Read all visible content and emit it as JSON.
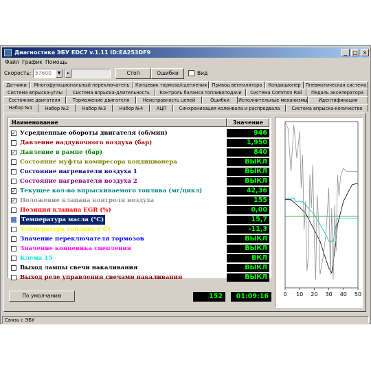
{
  "window": {
    "title": "Диагностика ЭБУ EDC7 v.1.11 ID:EA253DF9",
    "min": "_",
    "max": "□",
    "close": "×"
  },
  "menu": [
    "Файл",
    "График",
    "Помощь"
  ],
  "toolbar": {
    "speed_label": "Скорость:",
    "speed_value": "57600",
    "stop_label": "Стоп",
    "errors_label": "Ошибки",
    "view_label": "Вид"
  },
  "tabs": {
    "row1": [
      "Датчики",
      "Многофункциональный переключатель",
      "Концевик тормоза/сцепления",
      "Привод вентилятора",
      "Кондиционер",
      "Пневматическая система"
    ],
    "row2": [
      "Система впрыска-углы",
      "Система впрыска-длительность",
      "Контроль баланса топливоподачи",
      "Система Common Rail",
      "Педаль акселератора"
    ],
    "row3": [
      "Состояние двигателя",
      "Торможение двигателя",
      "Неисправность цепей",
      "Ошибки",
      "Исполнительные механизмы",
      "Идентификация"
    ],
    "row4": [
      "Набор №1",
      "Набор №2",
      "Набор №3",
      "Набор №4",
      "АЦП",
      "Синхронизация коленвала и распредвала",
      "Система впрыска-количество"
    ],
    "active": "Набор №1"
  },
  "table": {
    "header_name": "Наименование",
    "header_value": "Значение",
    "rows": [
      {
        "label": "Усредненные обороты двигателя (об/мин)",
        "value": "946",
        "checked": true,
        "color": "#000000"
      },
      {
        "label": "Давление наддувочного воздуха (бар)",
        "value": "1,950",
        "checked": false,
        "color": "#a00000"
      },
      {
        "label": "Давление в рампе (бар)",
        "value": "840",
        "checked": true,
        "color": "#008000"
      },
      {
        "label": "Состояние муфты компресора кондиционера",
        "value": "ВЫКЛ",
        "checked": false,
        "color": "#808000"
      },
      {
        "label": "Состояние нагревателя воздуха 1",
        "value": "ВЫКЛ",
        "checked": false,
        "color": "#000080"
      },
      {
        "label": "Состояние нагревателя воздуха 2",
        "value": "ВЫКЛ",
        "checked": false,
        "color": "#800080"
      },
      {
        "label": "Текущее кол-во впрыскиваемого топлива (мг/цикл)",
        "value": "42,36",
        "checked": true,
        "color": "#008080"
      },
      {
        "label": "Положение клапана контроля воздуха",
        "value": "155",
        "checked": true,
        "color": "#909090"
      },
      {
        "label": "Позиция клапана EGR (%)",
        "value": "0,00",
        "checked": false,
        "color": "#ff0000"
      },
      {
        "label": "Температура масла (°C)",
        "value": "15,7",
        "checked": false,
        "color": "#ffffff",
        "selected": true
      },
      {
        "label": "Температура топлива (°C)",
        "value": "-11,3",
        "checked": false,
        "color": "#ffff00"
      },
      {
        "label": "Значение переключателя тормозов",
        "value": "ВЫКЛ",
        "checked": false,
        "color": "#0000ff"
      },
      {
        "label": "Значение концевика сцепления",
        "value": "ВЫКЛ",
        "checked": false,
        "color": "#ff00ff"
      },
      {
        "label": "Клема 15",
        "value": "ВКЛ",
        "checked": false,
        "color": "#00e0e0"
      },
      {
        "label": "Выход лампы свечи накаливания",
        "value": "ВЫКЛ",
        "checked": false,
        "color": "#000000"
      },
      {
        "label": "Выход реле управления свечами накаливания",
        "value": "ВЫКЛ",
        "checked": false,
        "color": "#800000"
      }
    ]
  },
  "footer": {
    "default_button": "По умолчанию",
    "counter": "152",
    "time": "01:09:16"
  },
  "status": "Связь с ЭБУ",
  "chart_data": {
    "type": "line",
    "title": "",
    "xlabel": "",
    "ylabel": "",
    "xlim": [
      0,
      50
    ],
    "xticks": [
      0,
      10,
      20,
      30,
      40,
      50
    ],
    "series": [
      {
        "values": [
          [
            0,
            54
          ],
          [
            6,
            54
          ],
          [
            7,
            52
          ],
          [
            12,
            52
          ],
          [
            20,
            44
          ],
          [
            28,
            32
          ],
          [
            30,
            28
          ],
          [
            33,
            28
          ],
          [
            36,
            42
          ],
          [
            42,
            42
          ],
          [
            50,
            42
          ]
        ],
        "color": "#00c0c0"
      },
      {
        "values": [
          [
            0,
            43
          ],
          [
            50,
            43
          ]
        ],
        "color": "#008000"
      },
      {
        "values": [
          [
            0,
            53
          ],
          [
            4,
            53
          ],
          [
            8,
            50
          ],
          [
            14,
            45
          ],
          [
            24,
            28
          ],
          [
            28,
            17
          ],
          [
            30,
            12
          ],
          [
            32,
            9
          ],
          [
            34,
            22
          ],
          [
            36,
            38
          ],
          [
            40,
            52
          ],
          [
            46,
            62
          ],
          [
            50,
            63
          ]
        ],
        "color": "#000000"
      },
      {
        "values": [
          [
            0,
            100
          ],
          [
            2,
            96
          ],
          [
            4,
            70
          ],
          [
            5,
            84
          ],
          [
            6,
            98
          ],
          [
            8,
            78
          ],
          [
            10,
            94
          ],
          [
            11,
            60
          ],
          [
            12,
            80
          ],
          [
            13,
            35
          ],
          [
            14,
            52
          ],
          [
            15,
            10
          ],
          [
            16,
            20
          ],
          [
            17,
            68
          ],
          [
            18,
            48
          ],
          [
            19,
            74
          ],
          [
            20,
            30
          ],
          [
            21,
            5
          ],
          [
            22,
            56
          ],
          [
            23,
            40
          ],
          [
            24,
            8
          ],
          [
            26,
            18
          ],
          [
            28,
            32
          ],
          [
            30,
            60
          ],
          [
            31,
            8
          ],
          [
            32,
            48
          ],
          [
            33,
            5
          ],
          [
            34,
            50
          ],
          [
            35,
            22
          ],
          [
            36,
            68
          ],
          [
            37,
            55
          ],
          [
            38,
            67
          ],
          [
            40,
            72
          ],
          [
            42,
            70
          ],
          [
            50,
            70
          ]
        ],
        "color": "#909090"
      }
    ]
  }
}
